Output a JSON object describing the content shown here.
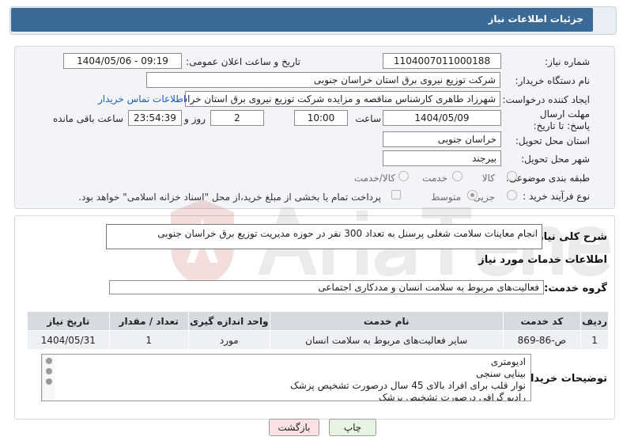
{
  "header": {
    "title": "جزئیات اطلاعات نیاز"
  },
  "need_info": {
    "need_number_label": "شماره نیاز:",
    "need_number": "1104007011000188",
    "announce_label": "تاریخ و ساعت اعلان عمومی:",
    "announce_value": "1404/05/06 - 09:19",
    "buyer_org_label": "نام دستگاه خریدار:",
    "buyer_org": "شرکت توزیع نیروی برق استان خراسان جنوبی",
    "creator_label": "ایجاد کننده درخواست:",
    "creator": "شهرزاد طاهری کارشناس مناقصه و مزایده شرکت توزیع نیروی برق استان خراسان جنوبی",
    "contact_link": "اطلاعات تماس خریدار",
    "deadline_label": "مهلت ارسال پاسخ: تا تاریخ:",
    "deadline_date": "1404/05/09",
    "time_label": "ساعت",
    "deadline_time": "10:00",
    "days_value": "2",
    "days_label": "روز و",
    "remaining_time": "23:54:39",
    "remaining_label": "ساعت باقی مانده",
    "province_label": "استان محل تحویل:",
    "province": "خراسان جنوبی",
    "city_label": "شهر محل تحویل:",
    "city": "بیرجند",
    "category_label": "طبقه بندی موضوعی:",
    "category_options": [
      "کالا",
      "خدمت",
      "کالا/خدمت"
    ],
    "process_label": "نوع فرآیند خرید :",
    "process_options": [
      "جزیی",
      "متوسط"
    ],
    "payment_note": "پرداخت تمام یا بخشی از مبلغ خرید،از محل \"اسناد خزانه اسلامی\" خواهد بود."
  },
  "summary": {
    "label": "شرح کلی نیاز:",
    "text": "انجام معاینات سلامت شغلی پرسنل به تعداد 300 نفر در حوزه مدیریت توزیع برق خراسان جنوبی"
  },
  "services": {
    "section_title": "اطلاعات خدمات مورد نیاز",
    "group_label": "گروه خدمت:",
    "group_value": "فعالیت‌های مربوط به سلامت انسان و مددکاری اجتماعی",
    "table": {
      "headers": [
        "ردیف",
        "کد خدمت",
        "نام خدمت",
        "واحد اندازه گیری",
        "تعداد / مقدار",
        "تاریخ نیاز"
      ],
      "rows": [
        [
          "1",
          "ص-86-869",
          "سایر فعالیت‌های مربوط به سلامت انسان",
          "مورد",
          "1",
          "1404/05/31"
        ]
      ]
    }
  },
  "buyer_notes": {
    "label": "توضیحات خریدار:",
    "lines": [
      "ادیومتری",
      "بینایی سنجی",
      "نوار قلب برای افراد بالای 45 سال درصورت تشخیص پزشک",
      "رادیو گرافی درصورت تشخیص پزشک"
    ]
  },
  "buttons": {
    "print": "چاپ",
    "back": "بازگشت"
  },
  "colors": {
    "header_bg": "#3b6a97",
    "back_button_bg": "#fbe3e3",
    "print_button_bg": "#e6f4e1"
  }
}
